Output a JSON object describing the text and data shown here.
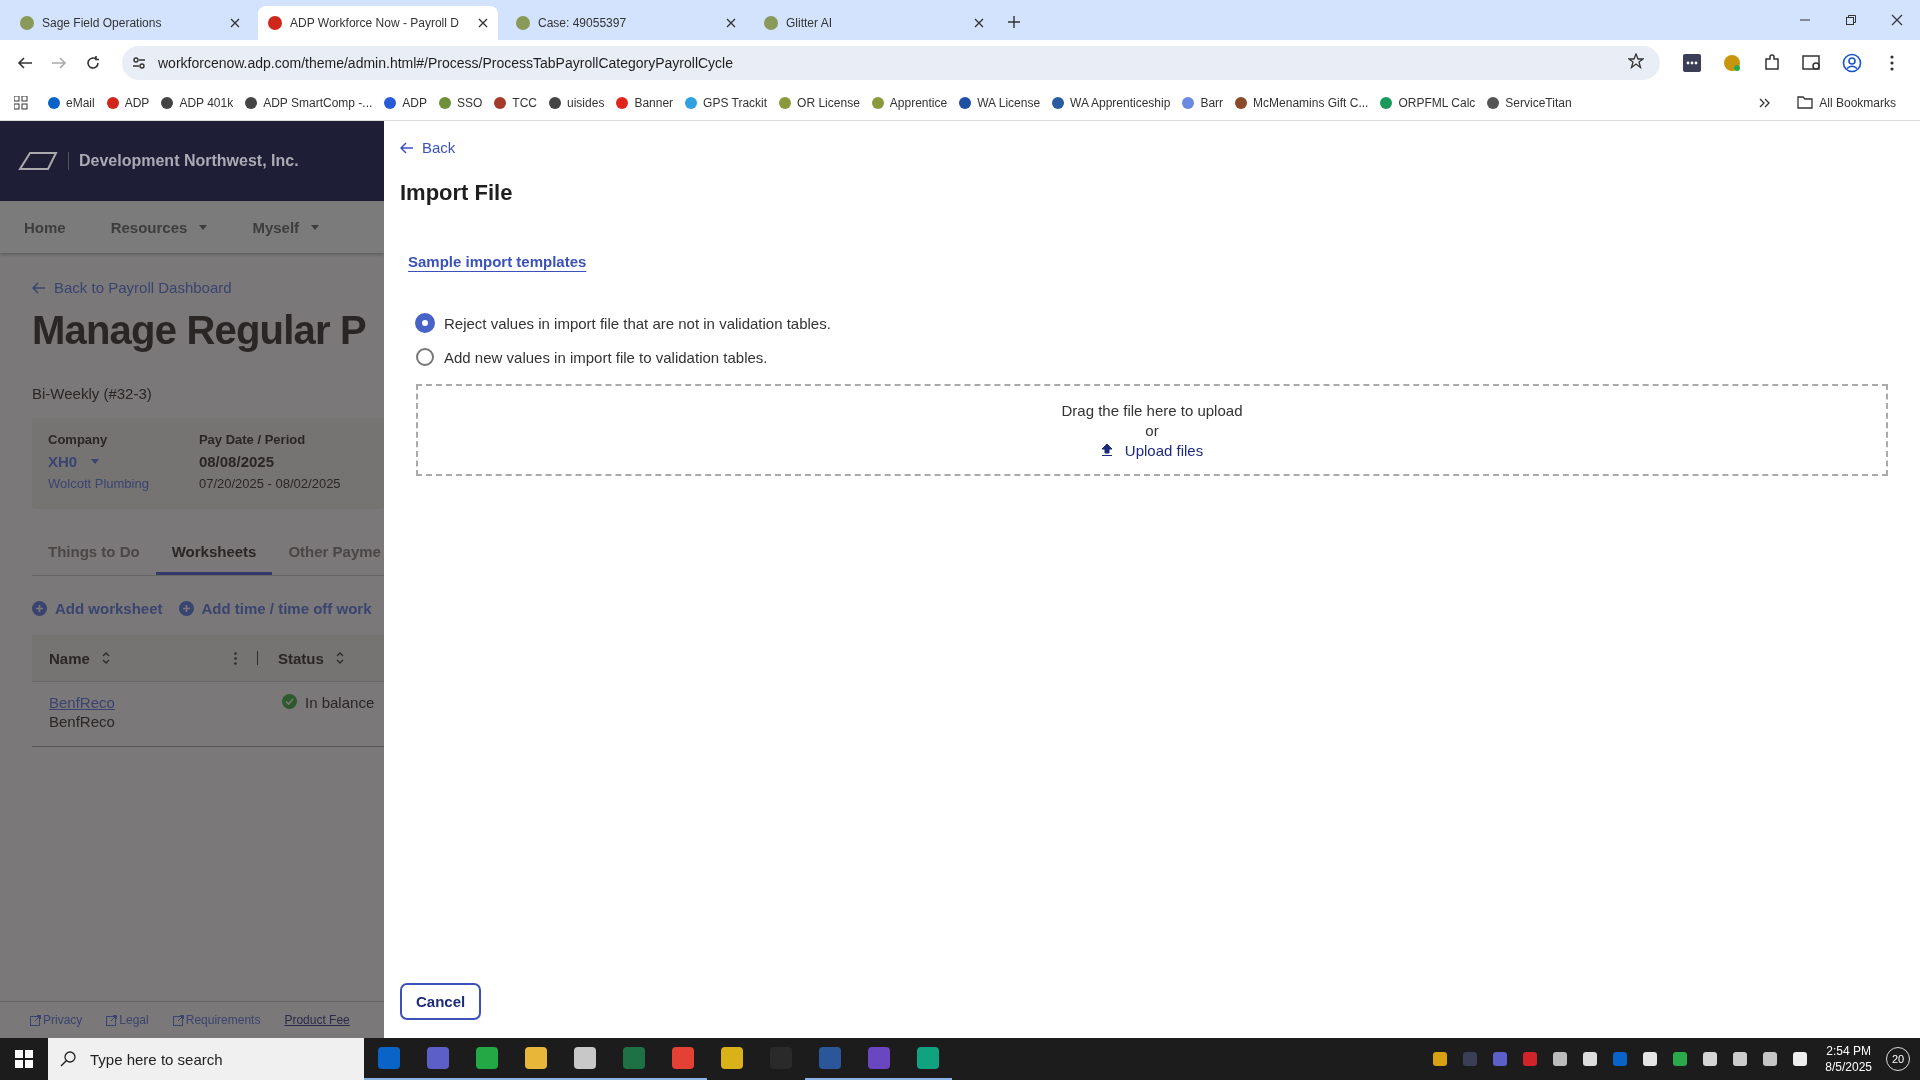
{
  "browser": {
    "tabs": [
      {
        "title": "Sage Field Operations",
        "selected": false
      },
      {
        "title": "ADP Workforce Now - Payroll D",
        "selected": true
      },
      {
        "title": "Case: 49055397",
        "selected": false
      },
      {
        "title": "Glitter AI",
        "selected": false
      }
    ],
    "address": "workforcenow.adp.com/theme/admin.html#/Process/ProcessTabPayrollCategoryPayrollCycle",
    "bookmarks": [
      {
        "label": "eMail",
        "color": "#0a64c8"
      },
      {
        "label": "ADP",
        "color": "#d0271d"
      },
      {
        "label": "ADP 401k",
        "color": "#444444"
      },
      {
        "label": "ADP SmartComp -...",
        "color": "#444444"
      },
      {
        "label": "ADP",
        "color": "#2a5bd7"
      },
      {
        "label": "SSO",
        "color": "#6f8f3a"
      },
      {
        "label": "TCC",
        "color": "#a33a2a"
      },
      {
        "label": "uisides",
        "color": "#444444"
      },
      {
        "label": "Banner",
        "color": "#e0261b"
      },
      {
        "label": "GPS Trackit",
        "color": "#2fa0e0"
      },
      {
        "label": "OR License",
        "color": "#8a9a3a"
      },
      {
        "label": "Apprentice",
        "color": "#8a9a3a"
      },
      {
        "label": "WA License",
        "color": "#1f4fa0"
      },
      {
        "label": "WA Apprenticeship",
        "color": "#2a5aa0"
      },
      {
        "label": "Barr",
        "color": "#6a8ae0"
      },
      {
        "label": "McMenamins Gift C...",
        "color": "#8a4a2a"
      },
      {
        "label": "ORPFML Calc",
        "color": "#1a9a5a"
      },
      {
        "label": "ServiceTitan",
        "color": "#555555"
      }
    ],
    "all_bookmarks": "All Bookmarks"
  },
  "app": {
    "company_name": "Development Northwest, Inc.",
    "nav": [
      {
        "label": "Home",
        "dropdown": false
      },
      {
        "label": "Resources",
        "dropdown": true
      },
      {
        "label": "Myself",
        "dropdown": true
      }
    ],
    "back_link": "Back to Payroll Dashboard",
    "page_title": "Manage Regular P",
    "frequency": "Bi-Weekly (#32-3)",
    "summary": {
      "company_label": "Company",
      "company_code": "XH0",
      "company_name": "Wolcott Plumbing",
      "pay_label": "Pay Date / Period",
      "pay_date": "08/08/2025",
      "period": "07/20/2025 - 08/02/2025"
    },
    "tabs": [
      {
        "label": "Things to Do",
        "selected": false
      },
      {
        "label": "Worksheets",
        "selected": true
      },
      {
        "label": "Other Payme",
        "selected": false
      }
    ],
    "actions": [
      "Add worksheet",
      "Add time / time off work"
    ],
    "table": {
      "columns": [
        "Name",
        "Status"
      ],
      "rows": [
        {
          "link": "BenfReco",
          "name": "BenfReco",
          "status": "In balance"
        }
      ]
    },
    "footer_links": [
      {
        "label": "Privacy",
        "external": true
      },
      {
        "label": "Legal",
        "external": true
      },
      {
        "label": "Requirements",
        "external": true
      },
      {
        "label": "Product Fee",
        "external": false
      }
    ]
  },
  "drawer": {
    "back": "Back",
    "title": "Import File",
    "templates_link": "Sample import templates",
    "options": [
      {
        "label": "Reject values in import file that are not in validation tables.",
        "selected": true
      },
      {
        "label": "Add new values in import file to validation tables.",
        "selected": false
      }
    ],
    "dropzone": {
      "text": "Drag the file here to upload",
      "or": "or",
      "upload": "Upload files"
    },
    "cancel": "Cancel"
  },
  "taskbar": {
    "search_placeholder": "Type here to search",
    "apps": [
      {
        "color": "#0a64c8",
        "open": true
      },
      {
        "color": "#5b5fc7",
        "open": true
      },
      {
        "color": "#22a845",
        "open": true
      },
      {
        "color": "#e8b73a",
        "open": true
      },
      {
        "color": "#c8c8c8",
        "open": true
      },
      {
        "color": "#1e7145",
        "open": true
      },
      {
        "color": "#e34133",
        "open": true
      },
      {
        "color": "#d9b21a",
        "open": false
      },
      {
        "color": "#2a2a2a",
        "open": false
      },
      {
        "color": "#2b579a",
        "open": true
      },
      {
        "color": "#6b46c1",
        "open": true
      },
      {
        "color": "#10a37f",
        "open": true
      }
    ],
    "tray": [
      {
        "color": "#d9a012"
      },
      {
        "color": "#3a3f55"
      },
      {
        "color": "#5b5fc7"
      },
      {
        "color": "#d0232a"
      },
      {
        "color": "#bbbbbb"
      },
      {
        "color": "#dddddd"
      },
      {
        "color": "#0a64c8"
      },
      {
        "color": "#e5e5e5"
      },
      {
        "color": "#2aa84a"
      },
      {
        "color": "#d5d5d5"
      },
      {
        "color": "#cccccc"
      },
      {
        "color": "#c5c5c5"
      },
      {
        "color": "#eeeeee"
      }
    ],
    "time": "2:54 PM",
    "date": "8/5/2025",
    "notifications": "20"
  }
}
